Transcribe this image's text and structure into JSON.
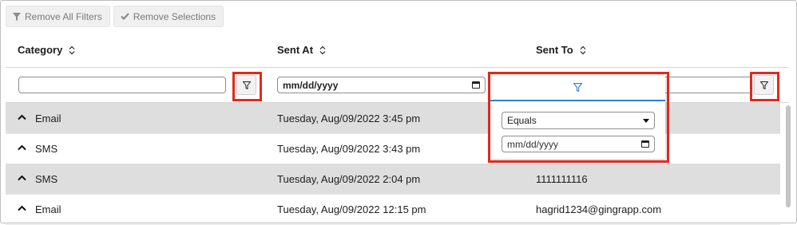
{
  "toolbar": {
    "remove_filters_label": "Remove All Filters",
    "remove_selections_label": "Remove Selections"
  },
  "columns": {
    "category": "Category",
    "sent_at": "Sent At",
    "sent_to": "Sent To"
  },
  "filters": {
    "category_value": "",
    "sent_at_placeholder": "mm/dd/yyyy",
    "sent_to_value": ""
  },
  "filter_panel": {
    "operator": "Equals",
    "date_placeholder": "mm/dd/yyyy"
  },
  "rows": [
    {
      "category": "Email",
      "sent_at": "Tuesday, Aug/09/2022 3:45 pm",
      "sent_to": ""
    },
    {
      "category": "SMS",
      "sent_at": "Tuesday, Aug/09/2022 3:43 pm",
      "sent_to": ""
    },
    {
      "category": "SMS",
      "sent_at": "Tuesday, Aug/09/2022 2:04 pm",
      "sent_to": "1111111116"
    },
    {
      "category": "Email",
      "sent_at": "Tuesday, Aug/09/2022 12:15 pm",
      "sent_to": "hagrid1234@gingrapp.com"
    }
  ],
  "colors": {
    "highlight": "#e2281c",
    "accent": "#2f7fd6",
    "row_alt": "#dedede"
  }
}
